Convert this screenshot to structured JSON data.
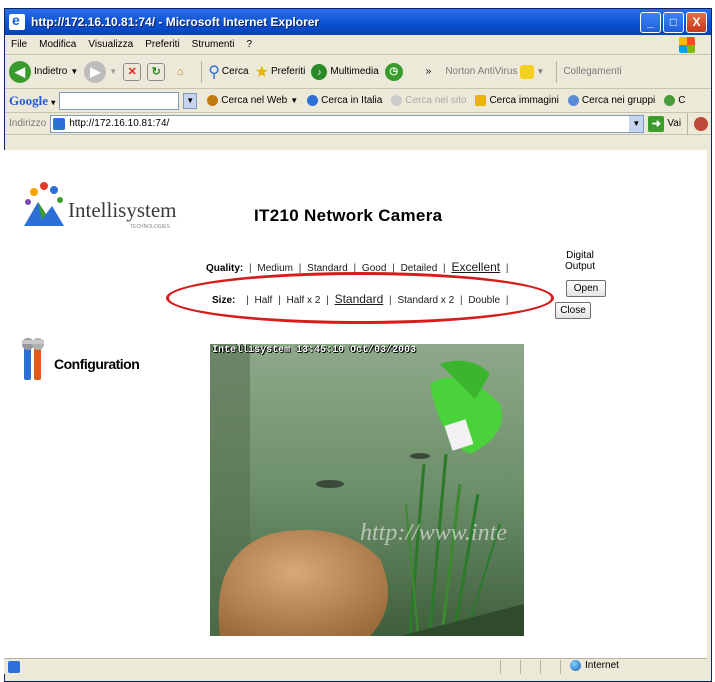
{
  "window": {
    "title": "http://172.16.10.81:74/ - Microsoft Internet Explorer",
    "min_btn": "_",
    "max_btn": "□",
    "close_btn": "X"
  },
  "menu": [
    "File",
    "Modifica",
    "Visualizza",
    "Preferiti",
    "Strumenti",
    "?"
  ],
  "toolbar": {
    "back": "Indietro",
    "search": "Cerca",
    "favorites": "Preferiti",
    "media": "Multimedia",
    "chevron": "»",
    "norton": "Norton AntiVirus",
    "links": "Collegamenti"
  },
  "google_bar": {
    "logo": "Google",
    "web": "Cerca nel Web",
    "italy": "Cerca in Italia",
    "site": "Cerca nel sito",
    "images": "Cerca immagini",
    "groups": "Cerca nei gruppi",
    "extra": "C"
  },
  "address": {
    "label": "Indirizzo",
    "url": "http://172.16.10.81:74/",
    "go": "Vai"
  },
  "page": {
    "logo_text": "Intellisystem",
    "logo_sub": "TECHNOLOGIES",
    "title": "IT210 Network Camera",
    "quality_label": "Quality:",
    "quality_options": [
      "Medium",
      "Standard",
      "Good",
      "Detailed",
      "Excellent"
    ],
    "size_label": "Size:",
    "size_options": [
      "Half",
      "Half x 2",
      "Standard",
      "Standard x 2",
      "Double"
    ],
    "digital_output_line1": "Digital",
    "digital_output_line2": "Output",
    "open_btn": "Open",
    "close_btn": "Close",
    "config_label": "Configuration",
    "osd_text": "Intellisystem 13:45:10 Oct/03/2003",
    "watermark": "http://www.inte"
  },
  "status": {
    "zone": "Internet"
  },
  "colors": {
    "annotation_ellipse": "#d81b1b",
    "title_bar": "#0a4fd0"
  }
}
